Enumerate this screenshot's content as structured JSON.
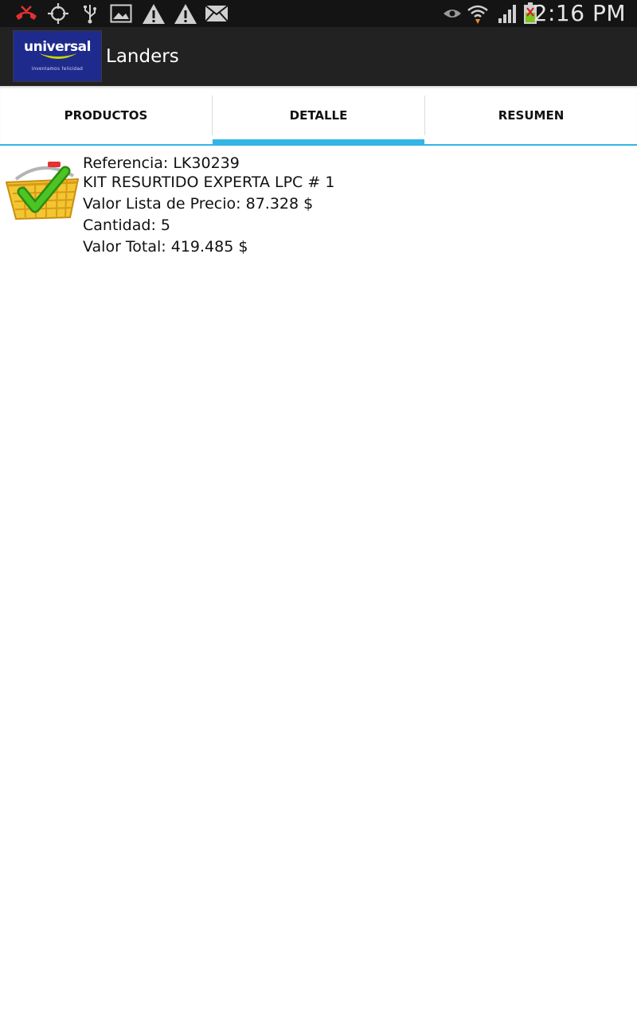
{
  "status_bar": {
    "time": "2:16 PM",
    "icons_left": [
      "missed-call-icon",
      "gps-icon",
      "usb-icon",
      "gallery-icon",
      "warning-icon",
      "warning-icon",
      "email-icon"
    ],
    "icons_right": [
      "eye-icon",
      "wifi-icon",
      "signal-icon",
      "battery-icon"
    ]
  },
  "action_bar": {
    "logo_text": "universal",
    "logo_tagline": "inventamos felicidad",
    "title": "Landers",
    "colors": {
      "background": "#222222",
      "logo_bg": "#1e2a8c",
      "logo_swoosh": "#c8d400"
    }
  },
  "tabs": [
    {
      "label": "PRODUCTOS",
      "selected": false
    },
    {
      "label": "DETALLE",
      "selected": true
    },
    {
      "label": "RESUMEN",
      "selected": false
    }
  ],
  "accent_color": "#33b5e5",
  "detail": {
    "icon": "basket-check-icon",
    "referencia": "Referencia: LK30239",
    "nombre": "KIT RESURTIDO EXPERTA LPC # 1",
    "valor_lista": "Valor Lista de Precio: 87.328 $",
    "cantidad": "Cantidad: 5",
    "valor_total": "Valor Total: 419.485 $"
  }
}
